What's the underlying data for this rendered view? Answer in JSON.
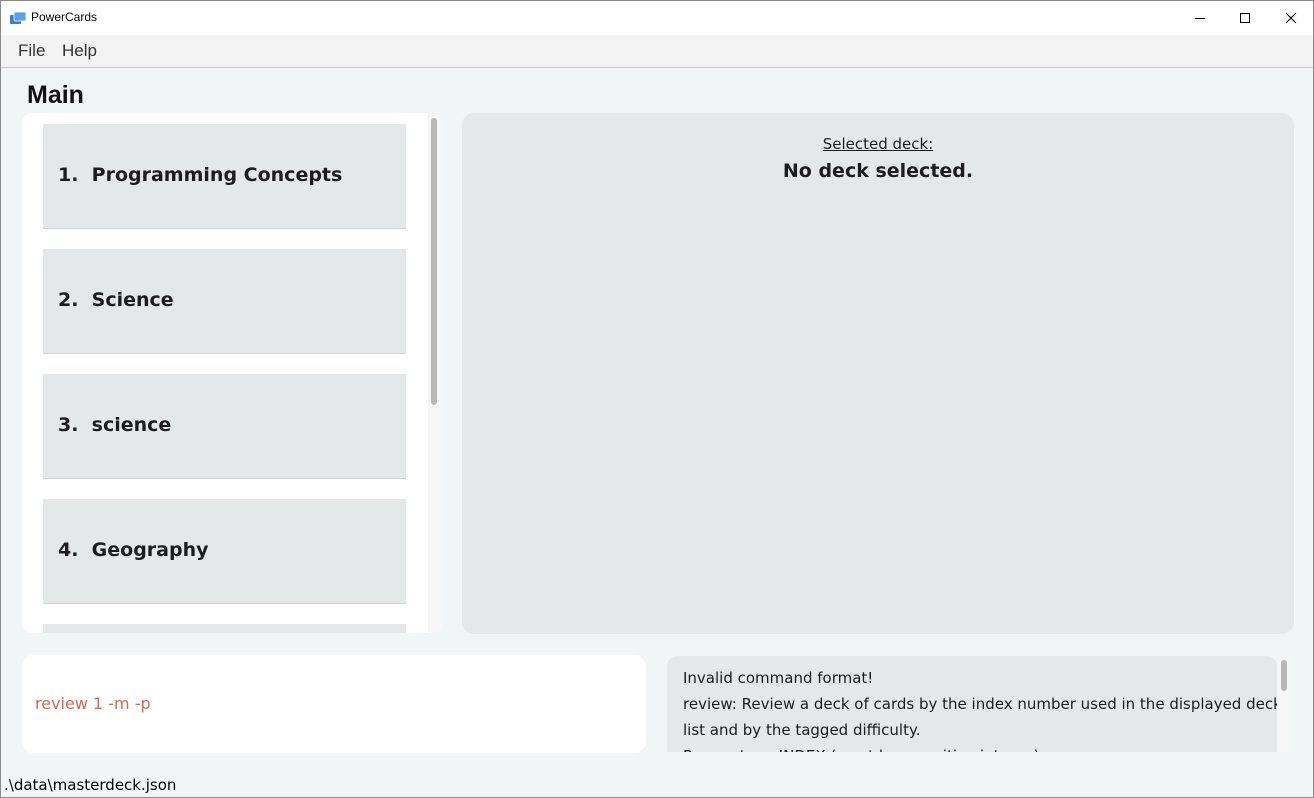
{
  "window": {
    "title": "PowerCards",
    "controls": [
      "minimize",
      "maximize",
      "close"
    ]
  },
  "menu": {
    "items": [
      {
        "label": "File"
      },
      {
        "label": "Help"
      }
    ]
  },
  "main": {
    "title": "Main"
  },
  "deck_list": {
    "items": [
      {
        "label": "1.  Programming Concepts"
      },
      {
        "label": "2.  Science"
      },
      {
        "label": "3.  science"
      },
      {
        "label": "4.  Geography"
      }
    ]
  },
  "selected_deck": {
    "caption": "Selected deck:",
    "value": "No deck selected."
  },
  "command_box": {
    "value": "review 1 -m -p"
  },
  "result_display": {
    "lines": [
      "Invalid command format!",
      "review: Review a deck of cards by the index number used in the displayed deck",
      "list and by the tagged difficulty.",
      "Parameters: INDEX (must be a positive integer)"
    ]
  },
  "status_bar": {
    "path": ".\\data\\masterdeck.json"
  },
  "colors": {
    "panel": "#e5e8e9",
    "background": "#f2f5f6",
    "command_text": "#d9684f"
  }
}
